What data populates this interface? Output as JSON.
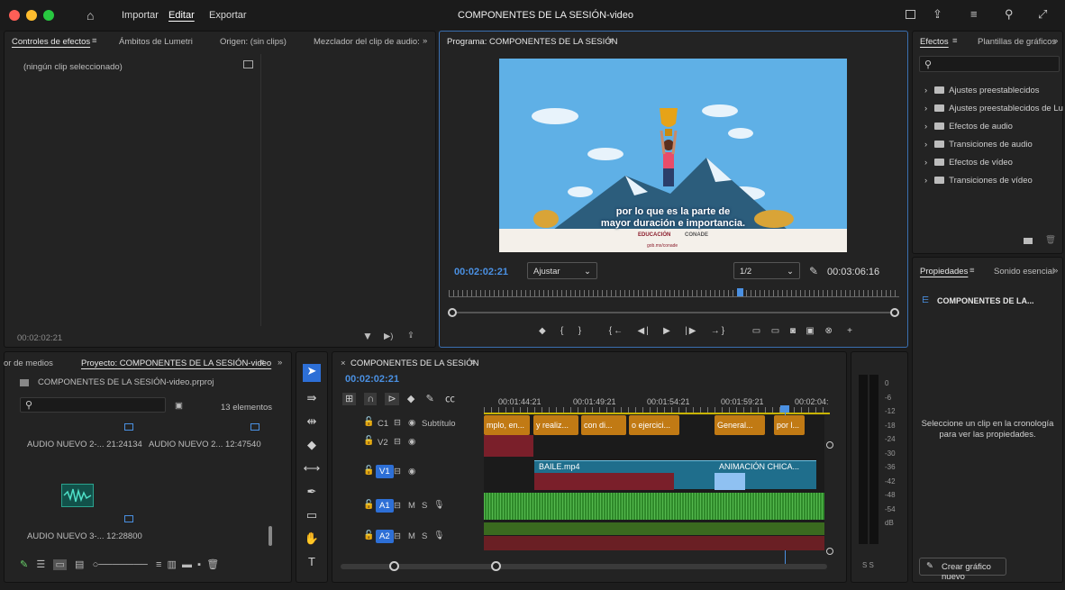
{
  "menu": {
    "home": "⌂",
    "import": "Importar",
    "edit": "Editar",
    "export": "Exportar",
    "title": "COMPONENTES DE LA SESIÓN-video"
  },
  "effect_controls": {
    "tabs": [
      "Controles de efectos",
      "Ámbitos de Lumetri",
      "Origen: (sin clips)",
      "Mezclador del clip de audio:"
    ],
    "no_clip": "(ningún clip seleccionado)",
    "timecode": "00:02:02:21"
  },
  "program": {
    "title": "Programa: COMPONENTES DE LA SESIÓN",
    "timecode": "00:02:02:21",
    "fit": "Ajustar",
    "scale": "1/2",
    "duration": "00:03:06:16",
    "caption_line1": "por lo que es la parte de",
    "caption_line2": "mayor duración e importancia.",
    "logo1": "EDUCACIÓN",
    "logo2": "CONADE",
    "footer_small": "gob.mx/conade"
  },
  "effects": {
    "tabs": [
      "Efectos",
      "Plantillas de gráficos"
    ],
    "items": [
      "Ajustes preestablecidos",
      "Ajustes preestablecidos de Lu",
      "Efectos de audio",
      "Transiciones de audio",
      "Efectos de vídeo",
      "Transiciones de vídeo"
    ]
  },
  "properties": {
    "tabs": [
      "Propiedades",
      "Sonido esencial"
    ],
    "sequence": "COMPONENTES DE LA...",
    "message": "Seleccione un clip en la cronología para ver las propiedades.",
    "button": "Crear gráfico nuevo"
  },
  "project": {
    "tabs": [
      "or de medios",
      "Proyecto: COMPONENTES DE LA SESIÓN-video"
    ],
    "file": "COMPONENTES DE LA SESIÓN-video.prproj",
    "count": "13 elementos",
    "items": [
      {
        "name": "AUDIO NUEVO 2-...",
        "dur": "21:24134"
      },
      {
        "name": "AUDIO NUEVO 2...",
        "dur": "12:47540"
      },
      {
        "name": "AUDIO NUEVO 3-...",
        "dur": "12:28800"
      }
    ]
  },
  "timeline": {
    "title": "COMPONENTES DE LA SESIÓN",
    "timecode": "00:02:02:21",
    "ruler": [
      "00:01:44:21",
      "00:01:49:21",
      "00:01:54:21",
      "00:01:59:21",
      "00:02:04:"
    ],
    "tracks": {
      "c1": "C1",
      "sub": "Subtítulo",
      "v2": "V2",
      "v1": "V1",
      "a1": "A1",
      "a2": "A2",
      "m": "M",
      "s": "S"
    },
    "captions": [
      "mplo, en...",
      "y realiz...",
      "con di...",
      "o ejercici...",
      "General...",
      "por l..."
    ],
    "video_clips": [
      "BAILE.mp4",
      "ANIMACIÓN CHICA..."
    ]
  },
  "meter": {
    "scale": [
      "0",
      "-6",
      "-12",
      "-18",
      "-24",
      "-30",
      "-36",
      "-42",
      "-48",
      "-54",
      "dB"
    ],
    "ss": "S  S"
  },
  "colors": {
    "accent": "#4a90e2",
    "caption_clip": "#c17a14",
    "video_clip": "#1f6e8c",
    "audio_clip": "#2f8a2a"
  }
}
